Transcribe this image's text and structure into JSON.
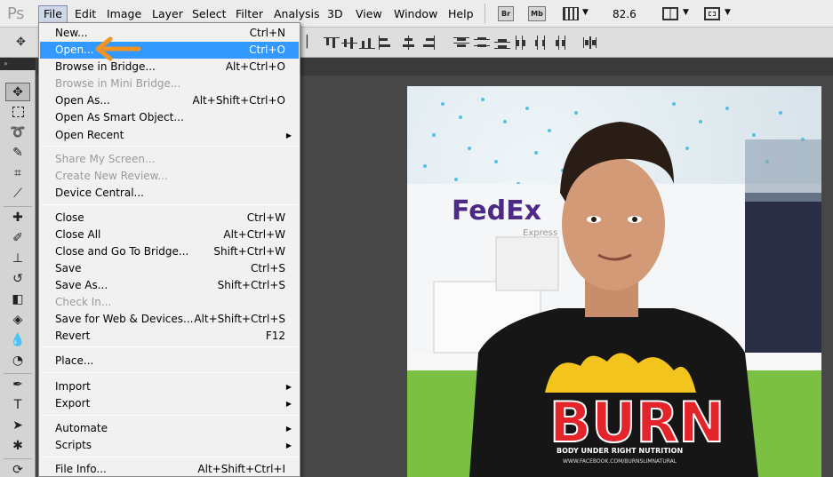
{
  "app": {
    "logo_text": "Ps"
  },
  "menubar": {
    "items": [
      "File",
      "Edit",
      "Image",
      "Layer",
      "Select",
      "Filter",
      "Analysis",
      "3D",
      "View",
      "Window",
      "Help"
    ],
    "bridge_button": "Br",
    "minibridge_button": "Mb",
    "zoom_value": "82.6"
  },
  "file_menu": {
    "items": [
      {
        "label": "New...",
        "shortcut": "Ctrl+N"
      },
      {
        "label": "Open...",
        "shortcut": "Ctrl+O",
        "highlighted": true
      },
      {
        "label": "Browse in Bridge...",
        "shortcut": "Alt+Ctrl+O"
      },
      {
        "label": "Browse in Mini Bridge...",
        "shortcut": "",
        "disabled": true
      },
      {
        "label": "Open As...",
        "shortcut": "Alt+Shift+Ctrl+O"
      },
      {
        "label": "Open As Smart Object...",
        "shortcut": ""
      },
      {
        "label": "Open Recent",
        "shortcut": "",
        "submenu": true
      },
      {
        "label": "Share My Screen...",
        "shortcut": "",
        "disabled": true
      },
      {
        "label": "Create New Review...",
        "shortcut": "",
        "disabled": true
      },
      {
        "label": "Device Central...",
        "shortcut": ""
      },
      {
        "label": "Close",
        "shortcut": "Ctrl+W"
      },
      {
        "label": "Close All",
        "shortcut": "Alt+Ctrl+W"
      },
      {
        "label": "Close and Go To Bridge...",
        "shortcut": "Shift+Ctrl+W"
      },
      {
        "label": "Save",
        "shortcut": "Ctrl+S"
      },
      {
        "label": "Save As...",
        "shortcut": "Shift+Ctrl+S"
      },
      {
        "label": "Check In...",
        "shortcut": "",
        "disabled": true
      },
      {
        "label": "Save for Web & Devices...",
        "shortcut": "Alt+Shift+Ctrl+S"
      },
      {
        "label": "Revert",
        "shortcut": "F12"
      },
      {
        "label": "Place...",
        "shortcut": ""
      },
      {
        "label": "Import",
        "shortcut": "",
        "submenu": true
      },
      {
        "label": "Export",
        "shortcut": "",
        "submenu": true
      },
      {
        "label": "Automate",
        "shortcut": "",
        "submenu": true
      },
      {
        "label": "Scripts",
        "shortcut": "",
        "submenu": true
      },
      {
        "label": "File Info...",
        "shortcut": "Alt+Shift+Ctrl+I"
      }
    ]
  },
  "photo": {
    "wall_logo": "FedEx",
    "wall_subtext": "Express",
    "shirt_text": "BURN",
    "shirt_tagline": "BODY UNDER RIGHT NUTRITION",
    "shirt_url": "WWW.FACEBOOK.COM/BURNSLIMNATURAL"
  },
  "colors": {
    "menu_highlight": "#3399ff",
    "arrow": "#f39321",
    "chrome": "#ececec",
    "workspace": "#474747"
  }
}
